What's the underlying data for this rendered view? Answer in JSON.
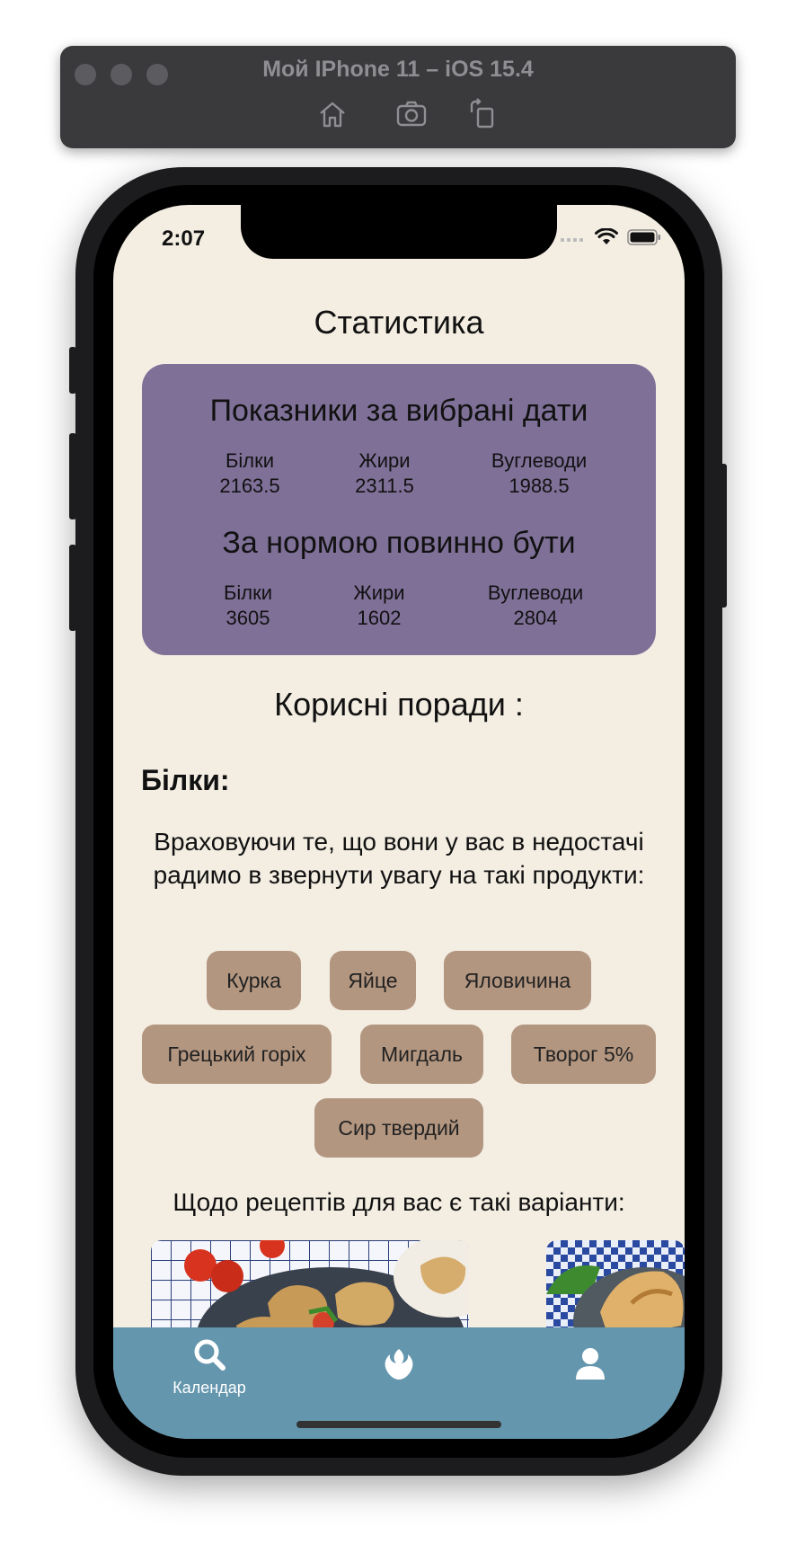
{
  "simulator": {
    "title": "Мой IPhone 11 – iOS 15.4",
    "tools": [
      "home-icon",
      "screenshot-icon",
      "rotate-icon"
    ]
  },
  "status_bar": {
    "time": "2:07"
  },
  "page": {
    "title": "Статистика"
  },
  "selected_dates": {
    "heading": "Показники за вибрані дати",
    "macros": [
      {
        "label": "Білки",
        "value": "2163.5"
      },
      {
        "label": "Жири",
        "value": "2311.5"
      },
      {
        "label": "Вуглеводи",
        "value": "1988.5"
      }
    ]
  },
  "norm": {
    "heading": "За нормою повинно бути",
    "macros": [
      {
        "label": "Білки",
        "value": "3605"
      },
      {
        "label": "Жири",
        "value": "1602"
      },
      {
        "label": "Вуглеводи",
        "value": "2804"
      }
    ]
  },
  "tips": {
    "title": "Корисні поради :",
    "section_label": "Білки:",
    "advice": "Враховуючи те, що вони у вас в недостачі радимо в звернути увагу на такі продукти:",
    "products": [
      "Курка",
      "Яйце",
      "Яловичина",
      "Грецький горіх",
      "Мигдаль",
      "Творог 5%",
      "Сир твердий"
    ],
    "recipes_label": "Щодо рецептів для вас є такі варіанти:"
  },
  "tab_bar": {
    "items": [
      {
        "label": "Календар",
        "icon": "search-icon"
      },
      {
        "label": "",
        "icon": "rebel-icon"
      },
      {
        "label": "",
        "icon": "person-icon"
      }
    ]
  },
  "colors": {
    "background": "#f3ede2",
    "card": "#7f7098",
    "chip": "#b39680",
    "tab_bar": "#6496ae"
  }
}
